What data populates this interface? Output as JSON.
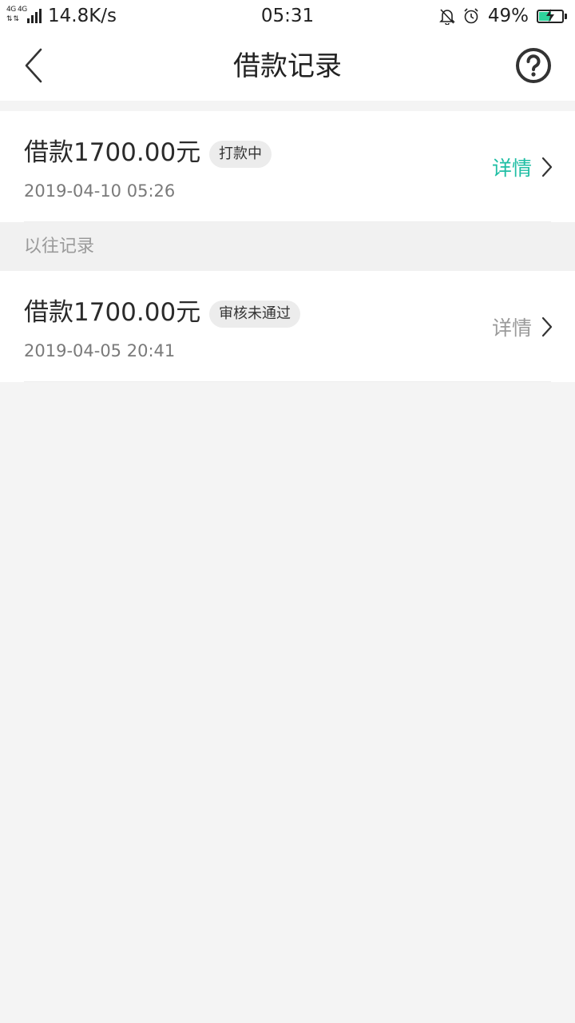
{
  "status_bar": {
    "network_label": "4G 4G",
    "network_speed": "14.8K/s",
    "time": "05:31",
    "battery": "49%",
    "battery_level": 0.49,
    "battery_color": "#2ed39b"
  },
  "header": {
    "title": "借款记录",
    "back_icon": "chevron-left-icon",
    "help_icon": "question-circle-icon"
  },
  "records": [
    {
      "amount": "借款1700.00元",
      "status": "打款中",
      "date": "2019-04-10 05:26",
      "detail_label": "详情",
      "detail_color": "#1fbea4"
    }
  ],
  "past_section": {
    "label": "以往记录"
  },
  "past_records": [
    {
      "amount": "借款1700.00元",
      "status": "审核未通过",
      "date": "2019-04-05 20:41",
      "detail_label": "详情",
      "detail_color": "#9a9a9a"
    }
  ],
  "colors": {
    "accent": "#1fbea4",
    "background": "#f4f4f4",
    "badge_bg": "#ececec"
  }
}
